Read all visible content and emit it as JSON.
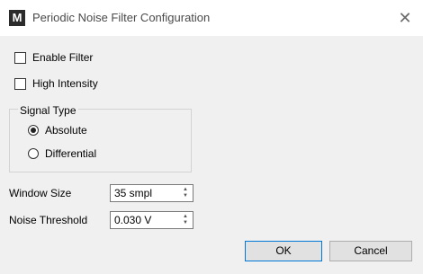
{
  "window": {
    "title": "Periodic Noise Filter Configuration",
    "app_icon": "M",
    "close_glyph": "✕"
  },
  "options": {
    "enable_filter": {
      "label": "Enable Filter",
      "checked": false
    },
    "high_intensity": {
      "label": "High Intensity",
      "checked": false
    }
  },
  "signal_type": {
    "label": "Signal Type",
    "options": [
      {
        "label": "Absolute",
        "selected": true
      },
      {
        "label": "Differential",
        "selected": false
      }
    ]
  },
  "fields": {
    "window_size": {
      "label": "Window Size",
      "value": "35 smpl"
    },
    "noise_threshold": {
      "label": "Noise Threshold",
      "value": "0.030 V"
    }
  },
  "buttons": {
    "ok": "OK",
    "cancel": "Cancel"
  },
  "colors": {
    "accent": "#0078d7"
  }
}
